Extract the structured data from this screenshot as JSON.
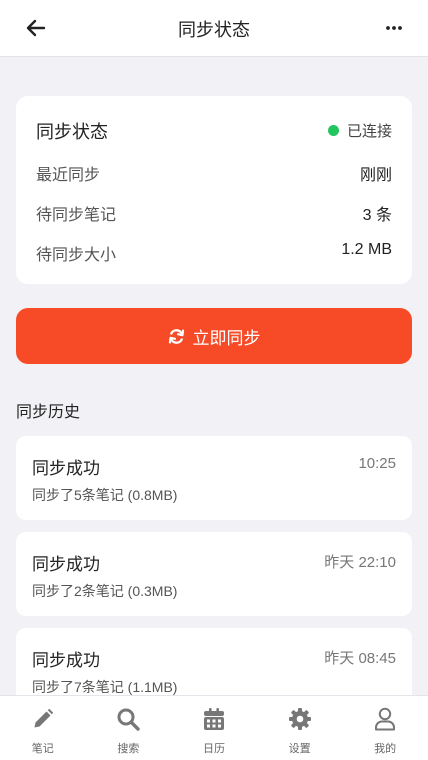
{
  "header": {
    "title": "同步状态"
  },
  "status": {
    "title": "同步状态",
    "connection": "已连接",
    "connection_color": "#22c55e",
    "rows": [
      {
        "label": "最近同步",
        "value": "刚刚"
      },
      {
        "label": "待同步笔记",
        "value": "3 条"
      },
      {
        "label": "待同步大小",
        "value": "1.2 MB"
      }
    ]
  },
  "sync_button": {
    "label": "立即同步",
    "color": "#f74b28"
  },
  "history": {
    "title": "同步历史",
    "items": [
      {
        "title": "同步成功",
        "time": "10:25",
        "desc": "同步了5条笔记 (0.8MB)"
      },
      {
        "title": "同步成功",
        "time": "昨天 22:10",
        "desc": "同步了2条笔记 (0.3MB)"
      },
      {
        "title": "同步成功",
        "time": "昨天 08:45",
        "desc": "同步了7条笔记 (1.1MB)"
      }
    ]
  },
  "tabs": [
    {
      "label": "笔记",
      "icon": "pencil-icon"
    },
    {
      "label": "搜索",
      "icon": "search-icon"
    },
    {
      "label": "日历",
      "icon": "calendar-icon"
    },
    {
      "label": "设置",
      "icon": "gear-icon"
    },
    {
      "label": "我的",
      "icon": "user-icon"
    }
  ]
}
